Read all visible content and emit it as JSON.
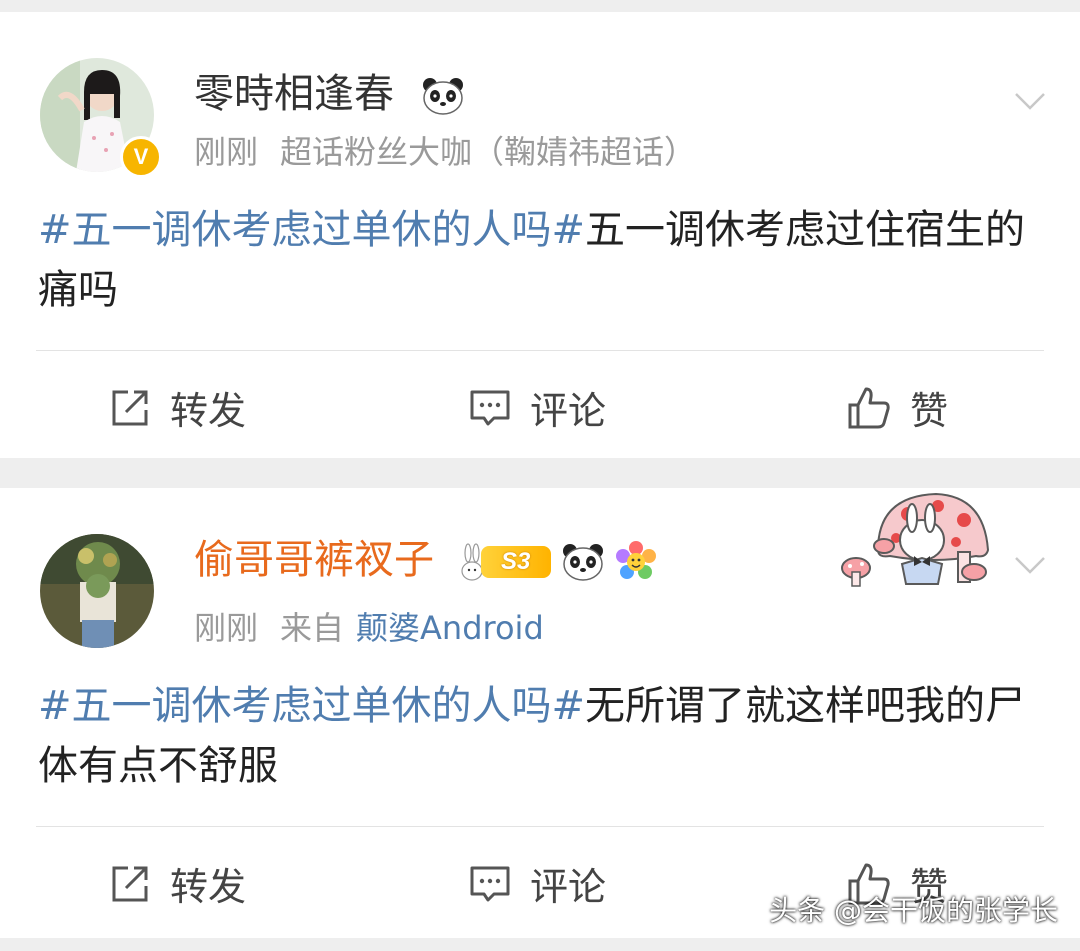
{
  "posts": [
    {
      "username": "零時相逢春",
      "time": "刚刚",
      "source": "超话粉丝大咖（鞠婧祎超话）",
      "hashtag": "#五一调休考虑过单休的人吗#",
      "body": "五一调休考虑过住宿生的痛吗",
      "verified_badge": "V",
      "actions": {
        "repost": "转发",
        "comment": "评论",
        "like": "赞"
      }
    },
    {
      "username": "偷哥哥裤衩子",
      "time": "刚刚",
      "source_prefix": "来自",
      "source_link": "颠婆Android",
      "hashtag": "#五一调休考虑过单休的人吗#",
      "body": "无所谓了就这样吧我的尸体有点不舒服",
      "level_badge": "S3",
      "actions": {
        "repost": "转发",
        "comment": "评论",
        "like": "赞"
      }
    }
  ],
  "watermark": "头条 @会干饭的张学长",
  "colors": {
    "link_blue": "#507daf",
    "vip_orange": "#e86a1d",
    "verified_gold": "#f7b500",
    "meta_gray": "#9a9a9a"
  },
  "icons": [
    "panda-icon",
    "rabbit-icon",
    "flower-icon",
    "mushroom-sticker",
    "repost-icon",
    "comment-icon",
    "like-icon",
    "chevron-down-icon"
  ]
}
